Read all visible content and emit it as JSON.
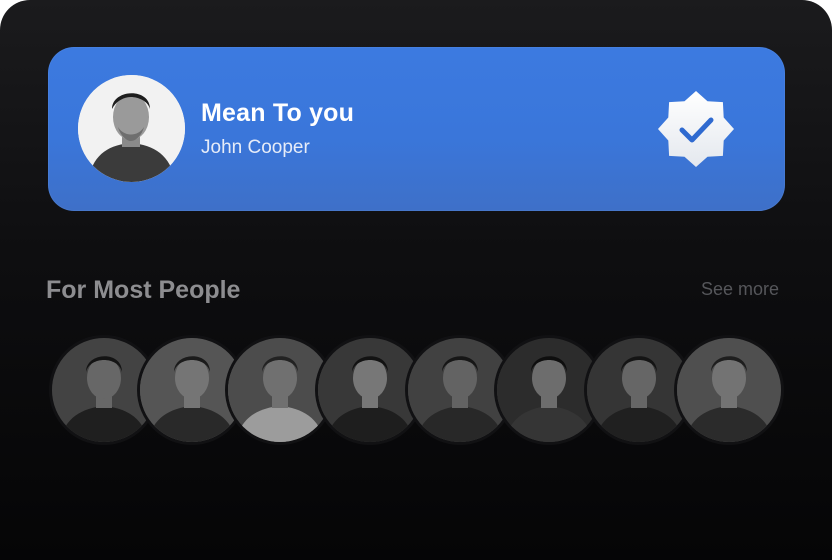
{
  "featured": {
    "title": "Mean To you",
    "artist": "John Cooper",
    "avatar_icon": "person-portrait-icon",
    "badge_icon": "verified-check-icon",
    "card_color": "#3a78dc"
  },
  "section": {
    "title": "For Most People",
    "see_more_label": "See more"
  },
  "people": [
    {
      "icon": "person-portrait-icon"
    },
    {
      "icon": "person-portrait-icon"
    },
    {
      "icon": "person-portrait-icon"
    },
    {
      "icon": "person-portrait-icon"
    },
    {
      "icon": "person-portrait-icon"
    },
    {
      "icon": "person-portrait-icon"
    },
    {
      "icon": "person-portrait-icon"
    },
    {
      "icon": "person-portrait-icon"
    }
  ]
}
